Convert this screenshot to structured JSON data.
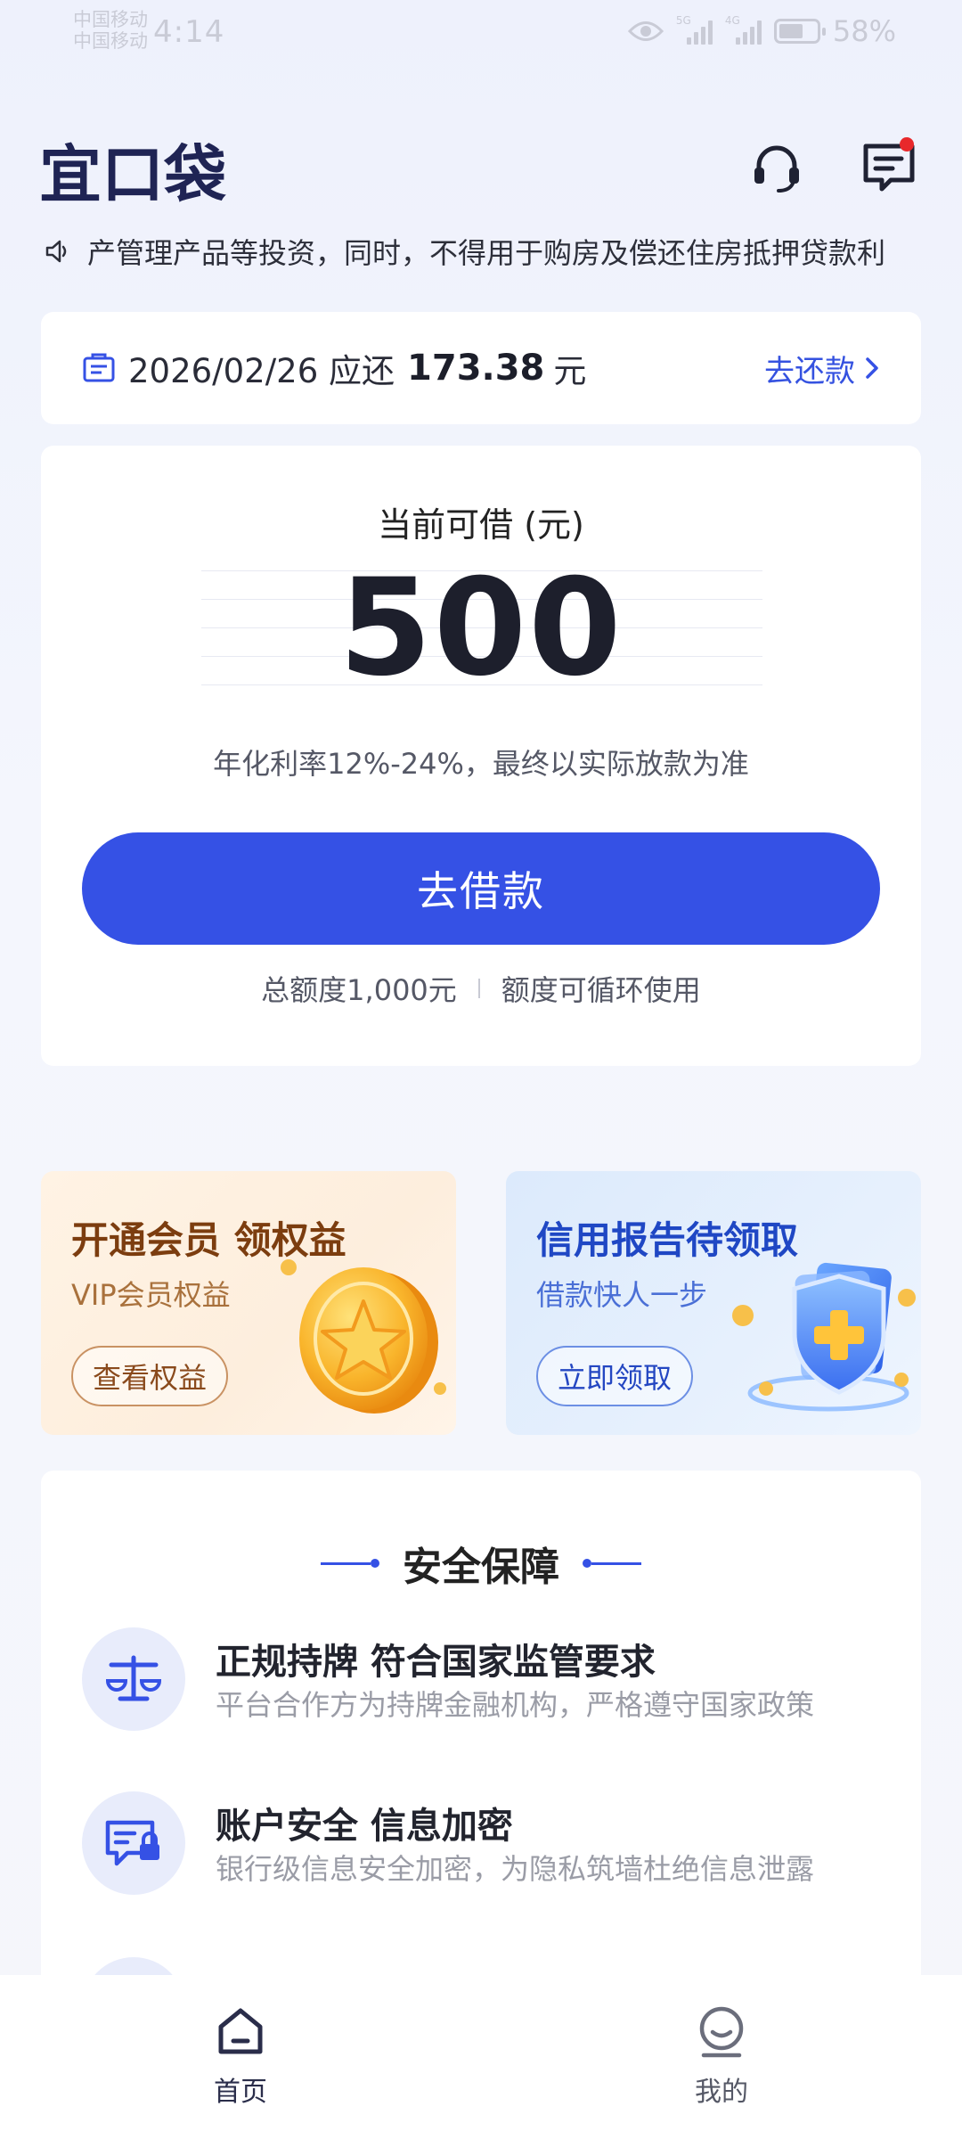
{
  "status_bar": {
    "carrier_1": "中国移动",
    "carrier_2": "中国移动",
    "time": "4:14",
    "network_1": "5G",
    "network_2": "4G",
    "battery": "58%"
  },
  "header": {
    "logo": "宜口袋",
    "icons": [
      "headset-icon",
      "message-icon"
    ],
    "has_unread_dot": true
  },
  "notice": {
    "icon": "speaker-icon",
    "text": "产管理产品等投资，同时，不得用于购房及偿还住房抵押贷款利"
  },
  "bill": {
    "icon": "bill-icon",
    "date_text": "2026/02/26 应还",
    "amount": "173.38",
    "unit": "元",
    "action": "去还款"
  },
  "loan": {
    "label": "当前可借 (元)",
    "amount": "500",
    "rate_note": "年化利率12%-24%，最终以实际放款为准",
    "button": "去借款",
    "total_limit": "总额度1,000元",
    "cycle_note": "额度可循环使用"
  },
  "promos": {
    "vip": {
      "title": "开通会员 领权益",
      "subtitle": "VIP会员权益",
      "button": "查看权益"
    },
    "credit": {
      "title": "信用报告待领取",
      "subtitle": "借款快人一步",
      "button": "立即领取"
    }
  },
  "security": {
    "title": "安全保障",
    "items": [
      {
        "icon": "balance-scale-icon",
        "title": "正规持牌 符合国家监管要求",
        "desc": "平台合作方为持牌金融机构，严格遵守国家政策"
      },
      {
        "icon": "secure-chat-icon",
        "title": "账户安全 信息加密",
        "desc": "银行级信息安全加密，为隐私筑墙杜绝信息泄露"
      }
    ]
  },
  "bottom_nav": {
    "items": [
      {
        "label": "首页",
        "icon": "home-icon",
        "active": true
      },
      {
        "label": "我的",
        "icon": "profile-icon",
        "active": false
      }
    ]
  },
  "colors": {
    "accent": "#3551e5",
    "logo": "#1f2454",
    "badge": "#e8282b"
  }
}
